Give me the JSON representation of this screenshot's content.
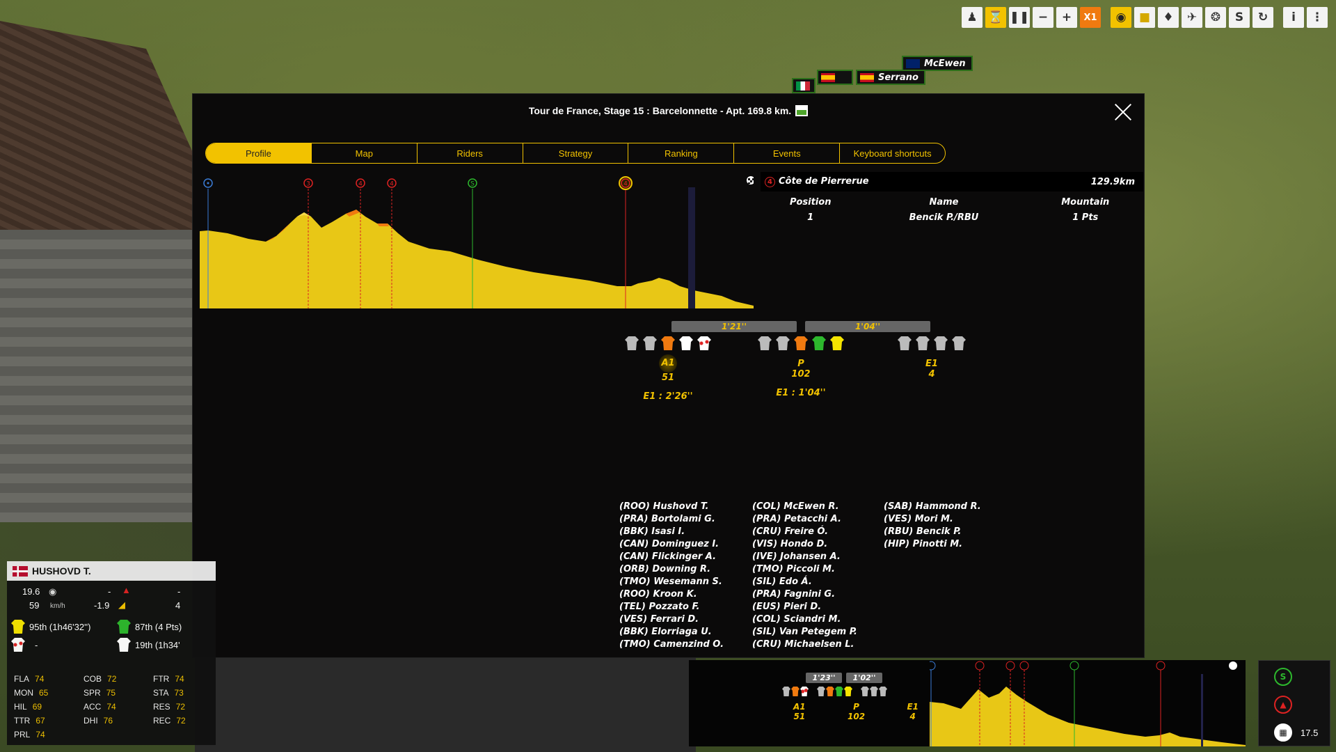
{
  "toolbar": {
    "speed_label": "X1",
    "buttons": [
      "rider-icon",
      "hourglass-icon",
      "pause-icon",
      "minus-icon",
      "plus-icon",
      "speed",
      "eye-icon",
      "car-icon",
      "moto-icon",
      "helicopter-icon",
      "wheel-icon",
      "sprint-icon",
      "refresh-icon",
      "info-icon",
      "menu-icon"
    ]
  },
  "tags": {
    "mcewen": "McEwen",
    "serrano": "Serrano"
  },
  "modal": {
    "title": "Tour de France, Stage 15 : Barcelonnette - Apt. 169.8 km.",
    "tabs": [
      "Profile",
      "Map",
      "Riders",
      "Strategy",
      "Ranking",
      "Events",
      "Keyboard shortcuts"
    ],
    "active_tab": "Profile"
  },
  "profile_markers": [
    {
      "label": "",
      "type": "start",
      "color": "#3a7bd5"
    },
    {
      "label": "3",
      "type": "climb",
      "color": "#d22"
    },
    {
      "label": "4",
      "type": "climb",
      "color": "#d22"
    },
    {
      "label": "4",
      "type": "climb",
      "color": "#d22"
    },
    {
      "label": "S",
      "type": "sprint",
      "color": "#2db82d"
    },
    {
      "label": "4",
      "type": "climb-selected",
      "color": "#d22"
    }
  ],
  "climb": {
    "cat": "4",
    "name": "Côte de Pierrerue",
    "km": "129.9km",
    "headers": [
      "Position",
      "Name",
      "Mountain"
    ],
    "rows": [
      {
        "position": "1",
        "name": "Bencik P./RBU",
        "points": "1 Pts"
      }
    ]
  },
  "gaps": [
    "1'21''",
    "1'04''"
  ],
  "groups": [
    {
      "label": "A1",
      "count": "51",
      "gap": "E1 : 2'26''"
    },
    {
      "label": "P",
      "count": "102",
      "gap": "E1 : 1'04''"
    },
    {
      "label": "E1",
      "count": "4",
      "gap": ""
    }
  ],
  "names_a1": [
    "(ROO) Hushovd T.",
    "(PRA) Bortolami G.",
    "(BBK) Isasi I.",
    "(CAN) Dominguez I.",
    "(CAN) Flickinger A.",
    "(ORB) Downing R.",
    "(TMO) Wesemann S.",
    "(ROO) Kroon K.",
    "(TEL) Pozzato F.",
    "(VES) Ferrari D.",
    "(BBK) Elorriaga U.",
    "(TMO) Camenzind O."
  ],
  "names_p": [
    "(COL) McEwen R.",
    "(PRA) Petacchi A.",
    "(CRU) Freire Ó.",
    "(VIS) Hondo D.",
    "(IVE) Johansen A.",
    "(TMO) Piccoli M.",
    "(SIL) Edo Á.",
    "(PRA) Fagnini G.",
    "(EUS) Pieri D.",
    "(COL) Sciandri M.",
    "(SIL) Van Petegem P.",
    "(CRU) Michaelsen L."
  ],
  "names_e1": [
    "(SAB) Hammond R.",
    "(VES) Mori M.",
    "(RBU) Bencik P.",
    "(HIP) Pinotti M."
  ],
  "rider": {
    "name": "HUSHOVD T.",
    "dist": "19.6",
    "speed": "59",
    "speed_unit": "km/h",
    "dash1": "-",
    "dash2": "-",
    "slope": "-1.9",
    "num": "4",
    "gc": "95th (1h46'32'')",
    "points": "87th (4 Pts)",
    "mountain": "-",
    "youth": "19th (1h34'",
    "stats": [
      {
        "k": "FLA",
        "v": "74"
      },
      {
        "k": "COB",
        "v": "72"
      },
      {
        "k": "FTR",
        "v": "74"
      },
      {
        "k": "MON",
        "v": "65"
      },
      {
        "k": "SPR",
        "v": "75"
      },
      {
        "k": "STA",
        "v": "73"
      },
      {
        "k": "HIL",
        "v": "69"
      },
      {
        "k": "ACC",
        "v": "74"
      },
      {
        "k": "RES",
        "v": "72"
      },
      {
        "k": "TTR",
        "v": "67"
      },
      {
        "k": "DHI",
        "v": "76"
      },
      {
        "k": "REC",
        "v": "72"
      },
      {
        "k": "PRL",
        "v": "74"
      }
    ]
  },
  "mini": {
    "gaps": [
      "1'23''",
      "1'02''"
    ],
    "groups": [
      {
        "label": "A1",
        "count": "51"
      },
      {
        "label": "P",
        "count": "102"
      },
      {
        "label": "E1",
        "count": "4"
      }
    ],
    "km_left": "17.5"
  },
  "colors": {
    "accent": "#f2c200",
    "climb": "#d22",
    "sprint": "#2db82d"
  }
}
